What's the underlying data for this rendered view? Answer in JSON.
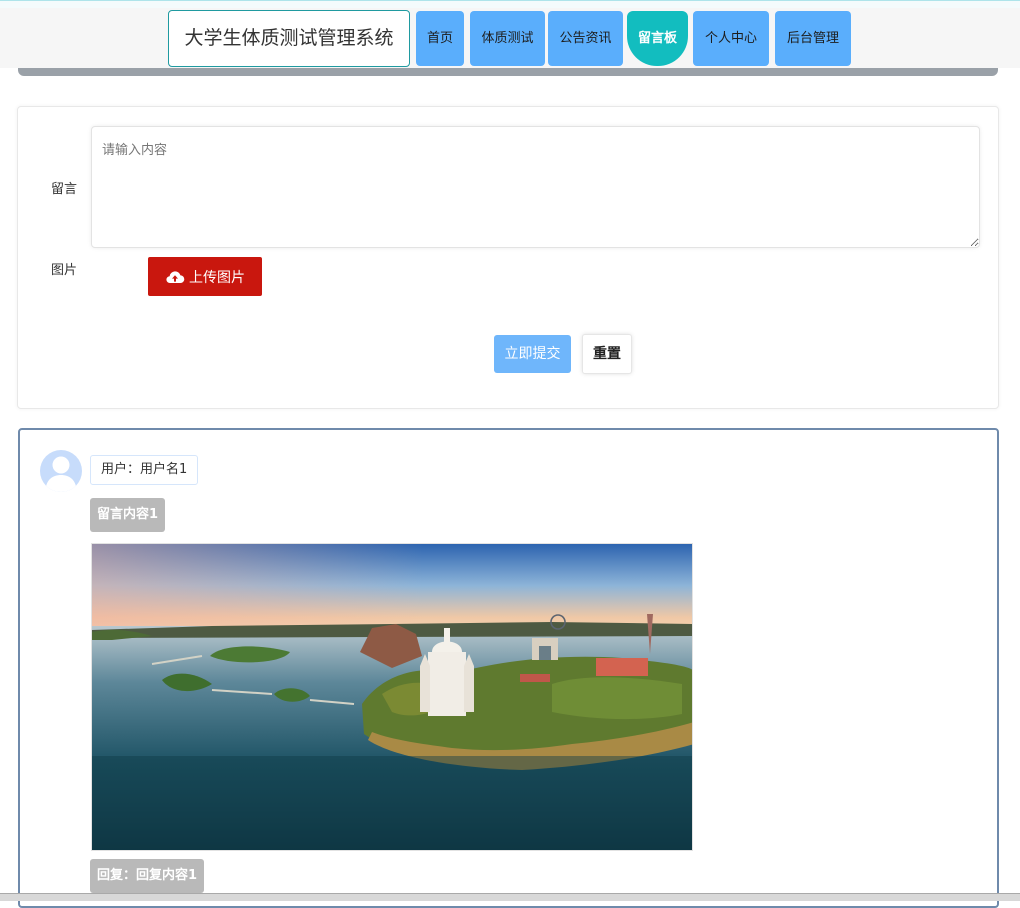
{
  "header": {
    "brand": "大学生体质测试管理系统",
    "nav": [
      {
        "label": "首页",
        "active": false
      },
      {
        "label": "体质测试",
        "active": false
      },
      {
        "label": "公告资讯",
        "active": false
      },
      {
        "label": "留言板",
        "active": true
      },
      {
        "label": "个人中心",
        "active": false
      },
      {
        "label": "后台管理",
        "active": false
      }
    ]
  },
  "form": {
    "message_label": "留言",
    "message_value": "",
    "message_placeholder": "请输入内容",
    "image_label": "图片",
    "upload_label": "上传图片",
    "submit_label": "立即提交",
    "reset_label": "重置"
  },
  "messages": [
    {
      "user": "用户：用户名1",
      "content": "留言内容1",
      "reply": "回复：回复内容1"
    }
  ],
  "colors": {
    "nav_button": "#5aaefc",
    "nav_active": "#12bdbf",
    "upload_button": "#c9170e",
    "submit_button": "#6fb6fb",
    "tag_grey": "#b9b9b9"
  },
  "icons": {
    "upload": "cloud-upload-icon",
    "avatar": "user-avatar-icon"
  }
}
